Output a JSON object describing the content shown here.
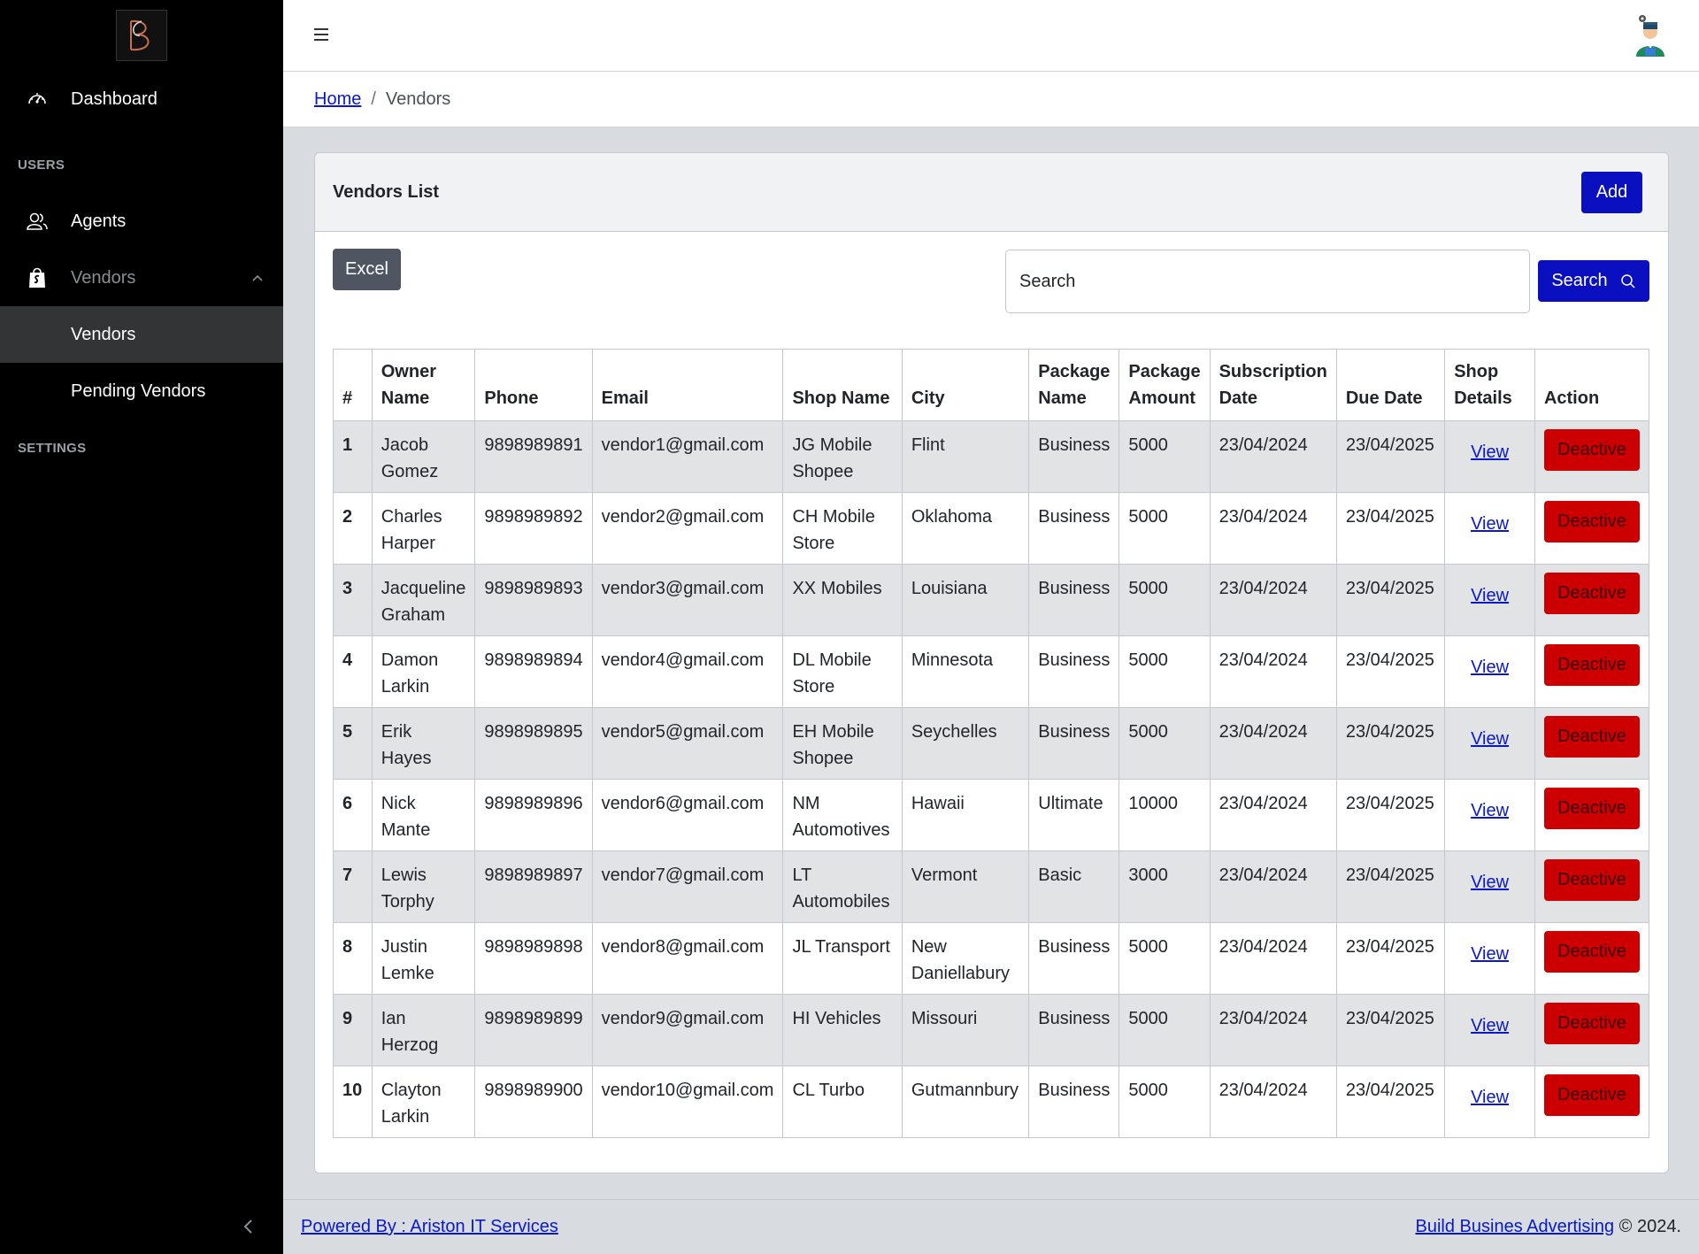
{
  "sidebar": {
    "dashboard_label": "Dashboard",
    "users_title": "USERS",
    "agents_label": "Agents",
    "vendors_label": "Vendors",
    "vendors_sub_label": "Vendors",
    "pending_vendors_label": "Pending Vendors",
    "settings_title": "SETTINGS"
  },
  "breadcrumb": {
    "home": "Home",
    "separator": "/",
    "current": "Vendors"
  },
  "card": {
    "title": "Vendors List",
    "add_label": "Add",
    "excel_label": "Excel",
    "search_placeholder": "Search",
    "search_button_label": "Search"
  },
  "table": {
    "headers": {
      "num": "#",
      "owner_line1": "Owner",
      "owner_line2": "Name",
      "phone": "Phone",
      "email": "Email",
      "shop_name": "Shop Name",
      "city": "City",
      "pkg_name_line1": "Package",
      "pkg_name_line2": "Name",
      "pkg_amt_line1": "Package",
      "pkg_amt_line2": "Amount",
      "sub_line1": "Subscription",
      "sub_line2": "Date",
      "due": "Due Date",
      "shop_line1": "Shop",
      "shop_line2": "Details",
      "action": "Action"
    },
    "rows": [
      {
        "num": "1",
        "owner": "Jacob Gomez",
        "phone": "9898989891",
        "email": "vendor1@gmail.com",
        "shop": "JG Mobile Shopee",
        "city": "Flint",
        "package": "Business",
        "amount": "5000",
        "sub_date": "23/04/2024",
        "due_date": "23/04/2025",
        "view": "View",
        "action": "Deactive"
      },
      {
        "num": "2",
        "owner": "Charles Harper",
        "phone": "9898989892",
        "email": "vendor2@gmail.com",
        "shop": "CH Mobile Store",
        "city": "Oklahoma",
        "package": "Business",
        "amount": "5000",
        "sub_date": "23/04/2024",
        "due_date": "23/04/2025",
        "view": "View",
        "action": "Deactive"
      },
      {
        "num": "3",
        "owner": "Jacqueline Graham",
        "phone": "9898989893",
        "email": "vendor3@gmail.com",
        "shop": "XX Mobiles",
        "city": "Louisiana",
        "package": "Business",
        "amount": "5000",
        "sub_date": "23/04/2024",
        "due_date": "23/04/2025",
        "view": "View",
        "action": "Deactive"
      },
      {
        "num": "4",
        "owner": "Damon Larkin",
        "phone": "9898989894",
        "email": "vendor4@gmail.com",
        "shop": "DL Mobile Store",
        "city": "Minnesota",
        "package": "Business",
        "amount": "5000",
        "sub_date": "23/04/2024",
        "due_date": "23/04/2025",
        "view": "View",
        "action": "Deactive"
      },
      {
        "num": "5",
        "owner": "Erik Hayes",
        "phone": "9898989895",
        "email": "vendor5@gmail.com",
        "shop": "EH Mobile Shopee",
        "city": "Seychelles",
        "package": "Business",
        "amount": "5000",
        "sub_date": "23/04/2024",
        "due_date": "23/04/2025",
        "view": "View",
        "action": "Deactive"
      },
      {
        "num": "6",
        "owner": "Nick Mante",
        "phone": "9898989896",
        "email": "vendor6@gmail.com",
        "shop": "NM Automotives",
        "city": "Hawaii",
        "package": "Ultimate",
        "amount": "10000",
        "sub_date": "23/04/2024",
        "due_date": "23/04/2025",
        "view": "View",
        "action": "Deactive"
      },
      {
        "num": "7",
        "owner": "Lewis Torphy",
        "phone": "9898989897",
        "email": "vendor7@gmail.com",
        "shop": "LT Automobiles",
        "city": "Vermont",
        "package": "Basic",
        "amount": "3000",
        "sub_date": "23/04/2024",
        "due_date": "23/04/2025",
        "view": "View",
        "action": "Deactive"
      },
      {
        "num": "8",
        "owner": "Justin Lemke",
        "phone": "9898989898",
        "email": "vendor8@gmail.com",
        "shop": "JL Transport",
        "city": "New Daniellabury",
        "package": "Business",
        "amount": "5000",
        "sub_date": "23/04/2024",
        "due_date": "23/04/2025",
        "view": "View",
        "action": "Deactive"
      },
      {
        "num": "9",
        "owner": "Ian Herzog",
        "phone": "9898989899",
        "email": "vendor9@gmail.com",
        "shop": "HI Vehicles",
        "city": "Missouri",
        "package": "Business",
        "amount": "5000",
        "sub_date": "23/04/2024",
        "due_date": "23/04/2025",
        "view": "View",
        "action": "Deactive"
      },
      {
        "num": "10",
        "owner": "Clayton Larkin",
        "phone": "9898989900",
        "email": "vendor10@gmail.com",
        "shop": "CL Turbo",
        "city": "Gutmannbury",
        "package": "Business",
        "amount": "5000",
        "sub_date": "23/04/2024",
        "due_date": "23/04/2025",
        "view": "View",
        "action": "Deactive"
      }
    ]
  },
  "footer": {
    "powered_by": "Powered By : Ariston IT Services",
    "brand_link": "Build Busines Advertising",
    "copyright": " © 2024."
  },
  "icons": {
    "dashboard": "speedometer-icon",
    "agents": "people-icon",
    "vendors": "shopping-bag-icon",
    "hamburger": "menu-icon",
    "search": "search-icon",
    "collapse": "chevron-left-icon"
  },
  "colors": {
    "primary": "#0a0fbf",
    "danger": "#cc0000",
    "sidebar": "#000000",
    "link": "#0a19c4"
  }
}
